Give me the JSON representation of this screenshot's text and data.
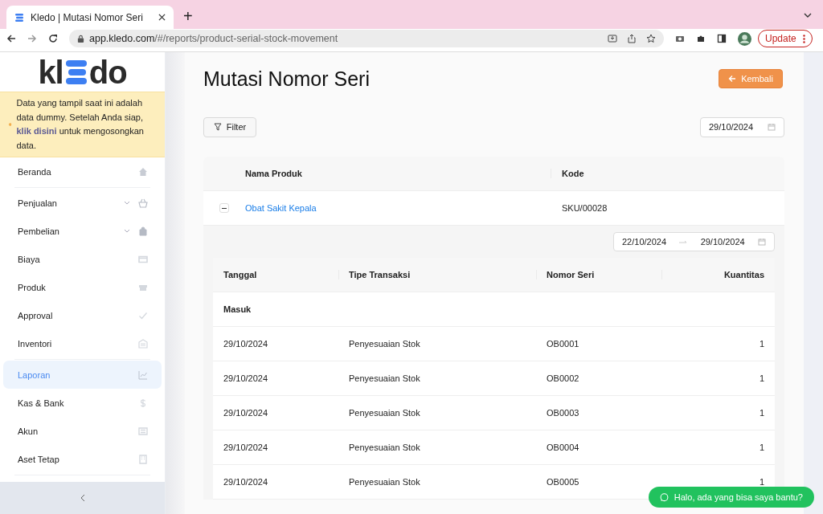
{
  "browser": {
    "tab_title": "Kledo | Mutasi Nomor Seri",
    "new_tab": "+",
    "url_host": "app.kledo.com",
    "url_path": "/#/reports/product-serial-stock-movement",
    "update_label": "Update"
  },
  "sidebar": {
    "logo": {
      "left": "kl",
      "right": "do"
    },
    "notice": {
      "before": "Data yang tampil saat ini adalah data dummy. Setelah Anda siap, ",
      "link": "klik disini",
      "after": " untuk mengosongkan data."
    },
    "items": [
      {
        "label": "Beranda",
        "selected": false,
        "has_submenu": false,
        "divider_after": true
      },
      {
        "label": "Penjualan",
        "selected": false,
        "has_submenu": true,
        "divider_after": false
      },
      {
        "label": "Pembelian",
        "selected": false,
        "has_submenu": true,
        "divider_after": false
      },
      {
        "label": "Biaya",
        "selected": false,
        "has_submenu": false,
        "divider_after": false
      },
      {
        "label": "Produk",
        "selected": false,
        "has_submenu": false,
        "divider_after": false
      },
      {
        "label": "Approval",
        "selected": false,
        "has_submenu": false,
        "divider_after": false
      },
      {
        "label": "Inventori",
        "selected": false,
        "has_submenu": false,
        "divider_after": true
      },
      {
        "label": "Laporan",
        "selected": true,
        "has_submenu": false,
        "divider_after": false
      },
      {
        "label": "Kas & Bank",
        "selected": false,
        "has_submenu": false,
        "divider_after": false
      },
      {
        "label": "Akun",
        "selected": false,
        "has_submenu": false,
        "divider_after": false
      },
      {
        "label": "Aset Tetap",
        "selected": false,
        "has_submenu": false,
        "divider_after": true
      }
    ]
  },
  "page": {
    "title": "Mutasi Nomor Seri",
    "back_button": "Kembali",
    "filter_button": "Filter",
    "date": "29/10/2024",
    "table": {
      "columns": [
        "Nama Produk",
        "Kode"
      ],
      "rows": [
        {
          "name": "Obat Sakit Kepala",
          "code": "SKU/00028",
          "expanded": true,
          "detail": {
            "range_start": "22/10/2024",
            "range_end": "29/10/2024",
            "columns": [
              "Tanggal",
              "Tipe Transaksi",
              "Nomor Seri",
              "Kuantitas"
            ],
            "section": "Masuk",
            "rows": [
              {
                "date": "29/10/2024",
                "type": "Penyesuaian Stok",
                "serial": "OB0001",
                "qty": "1"
              },
              {
                "date": "29/10/2024",
                "type": "Penyesuaian Stok",
                "serial": "OB0002",
                "qty": "1"
              },
              {
                "date": "29/10/2024",
                "type": "Penyesuaian Stok",
                "serial": "OB0003",
                "qty": "1"
              },
              {
                "date": "29/10/2024",
                "type": "Penyesuaian Stok",
                "serial": "OB0004",
                "qty": "1"
              },
              {
                "date": "29/10/2024",
                "type": "Penyesuaian Stok",
                "serial": "OB0005",
                "qty": "1"
              }
            ]
          }
        }
      ]
    }
  },
  "chat_button": "Halo, ada yang bisa saya bantu?"
}
